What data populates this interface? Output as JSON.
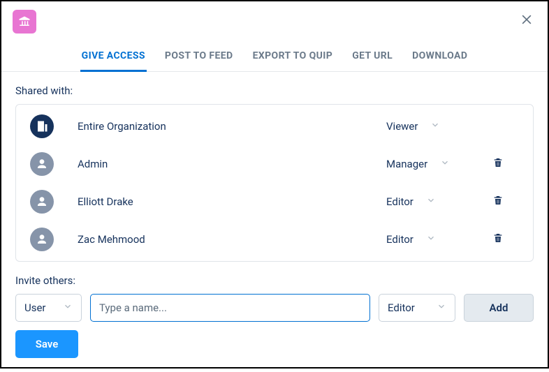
{
  "header": {
    "close_aria": "Close"
  },
  "tabs": [
    {
      "label": "GIVE ACCESS",
      "active": true
    },
    {
      "label": "POST TO FEED",
      "active": false
    },
    {
      "label": "EXPORT TO QUIP",
      "active": false
    },
    {
      "label": "GET URL",
      "active": false
    },
    {
      "label": "DOWNLOAD",
      "active": false
    }
  ],
  "shared_with_label": "Shared with:",
  "shares": [
    {
      "name": "Entire Organization",
      "role": "Viewer",
      "type": "org",
      "removable": false
    },
    {
      "name": "Admin",
      "role": "Manager",
      "type": "user",
      "removable": true
    },
    {
      "name": "Elliott Drake",
      "role": "Editor",
      "type": "user",
      "removable": true
    },
    {
      "name": "Zac Mehmood",
      "role": "Editor",
      "type": "user",
      "removable": true
    }
  ],
  "invite_label": "Invite others:",
  "invite": {
    "type_value": "User",
    "name_placeholder": "Type a name...",
    "role_value": "Editor",
    "add_label": "Add"
  },
  "save_label": "Save",
  "colors": {
    "accent": "#0070d2",
    "save_bg": "#1b96ff",
    "app_icon_bg": "#e875d2"
  }
}
